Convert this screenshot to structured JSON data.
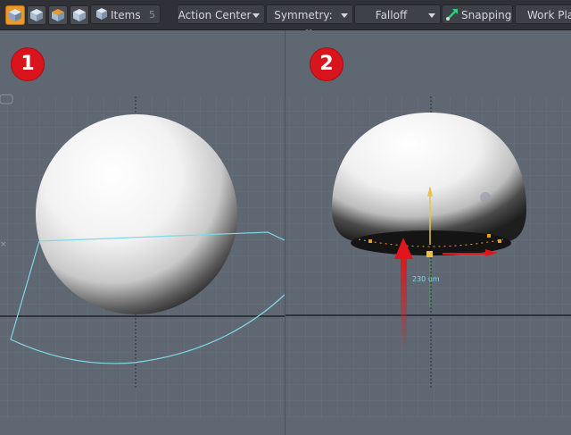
{
  "toolbar": {
    "items_label": "Items",
    "items_count": "5",
    "action_center_label": "Action Center",
    "symmetry_label": "Symmetry: Off",
    "falloff_label": "Falloff",
    "snapping_label": "Snapping",
    "work_plane_label": "Work Plane",
    "mode_icons": [
      "vertices-mode-icon",
      "edges-mode-icon",
      "polygons-mode-icon",
      "items-mode-icon"
    ]
  },
  "viewports": [
    {
      "badge": "1"
    },
    {
      "badge": "2",
      "measure_label": "230 um"
    }
  ],
  "colors": {
    "badge": "#d9141c",
    "viewport_bg": "#5f6773",
    "falloff_curve": "#7fd9e6",
    "gizmo_arrow": "#e0161c",
    "accent_orange": "#f29a1f"
  }
}
